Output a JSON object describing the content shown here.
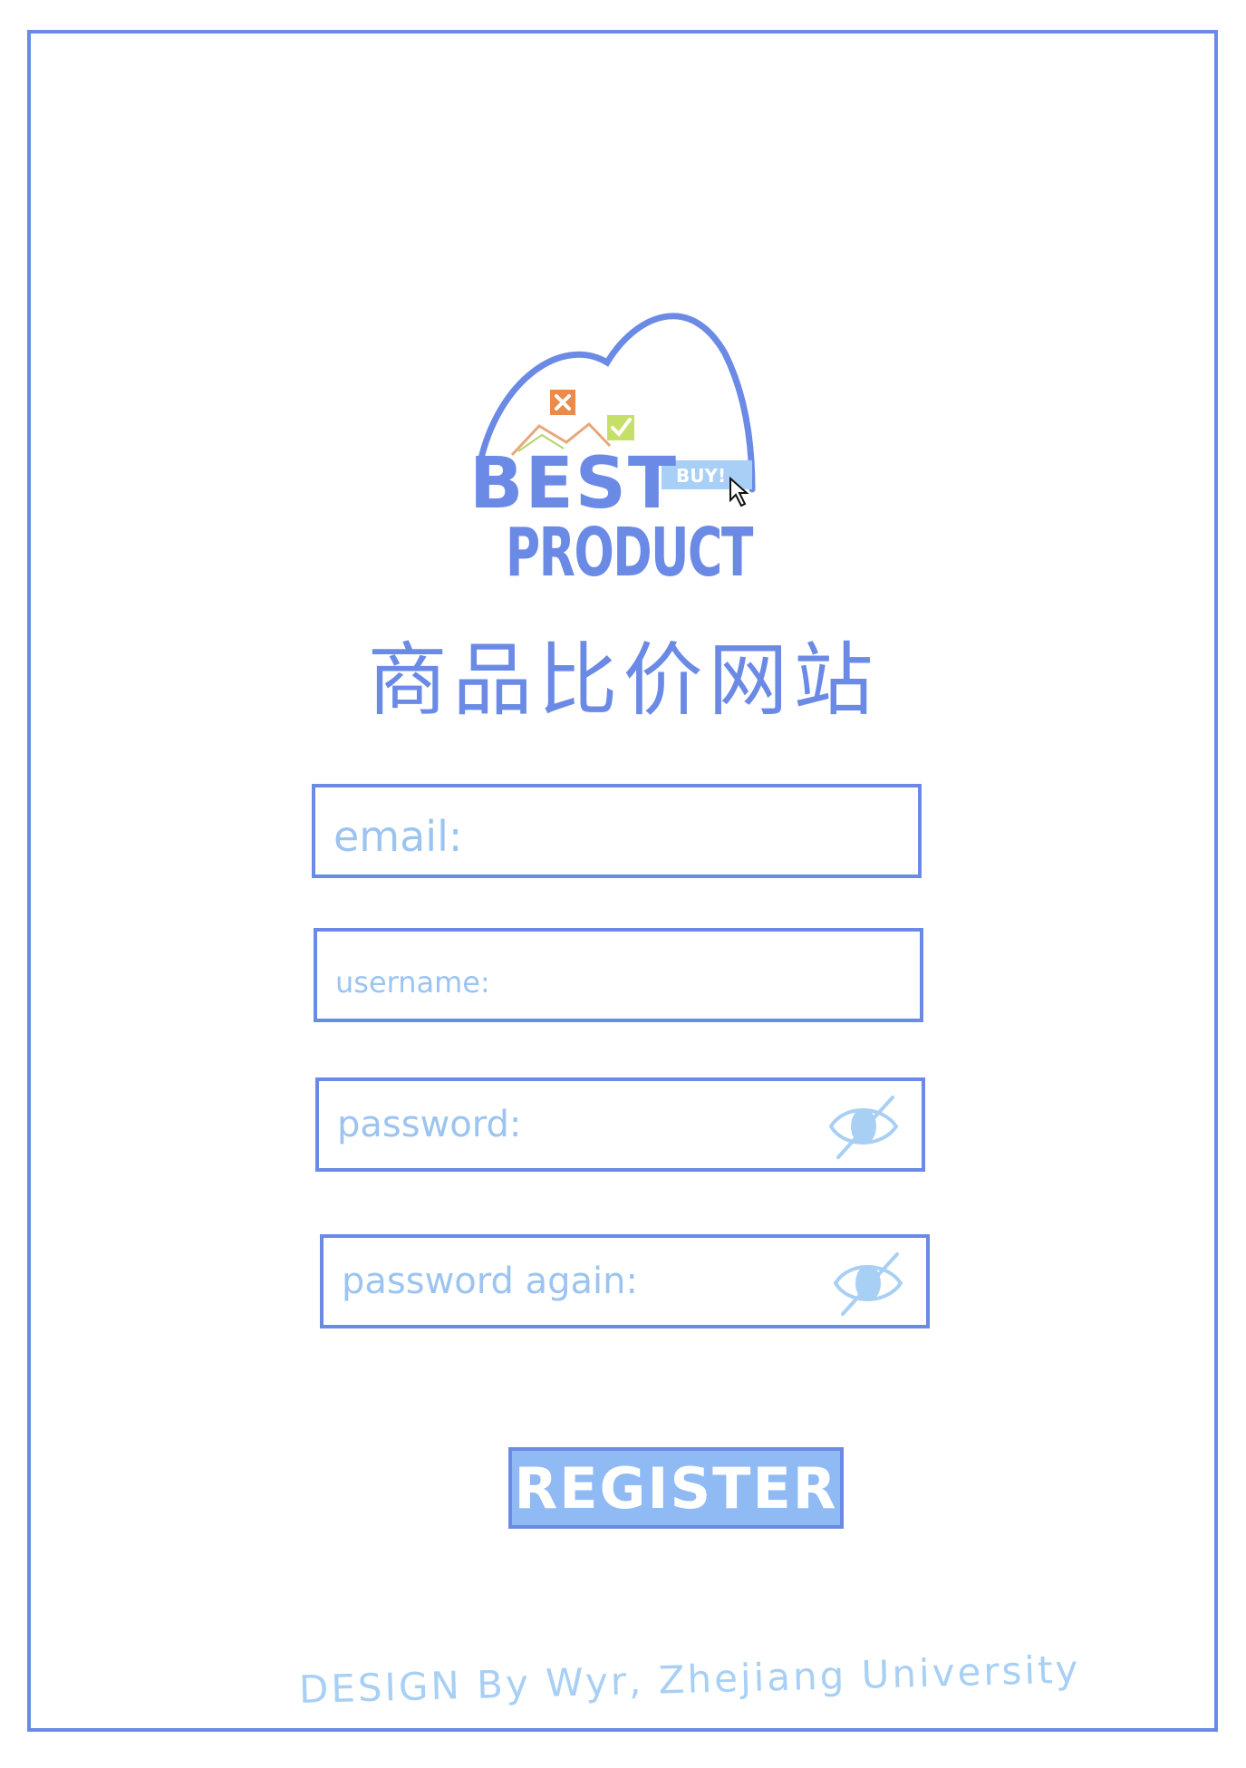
{
  "logo": {
    "text_line1": "BEST",
    "text_line2": "PRODUCT",
    "badge": "BUY!",
    "icons": [
      "x-icon",
      "check-icon",
      "cursor-icon"
    ],
    "colors": {
      "primary": "#6b8ae6",
      "badge": "#a8cff5",
      "x": "#ec8a4a",
      "check": "#c6e067"
    }
  },
  "page": {
    "title": "商品比价网站"
  },
  "form": {
    "email_placeholder": "email:",
    "username_placeholder": "username:",
    "password_placeholder": "password:",
    "password_again_placeholder": "password again:",
    "register_label": "REGISTER"
  },
  "footer": {
    "credit": "DESIGN By Wyr, Zhejiang University"
  }
}
